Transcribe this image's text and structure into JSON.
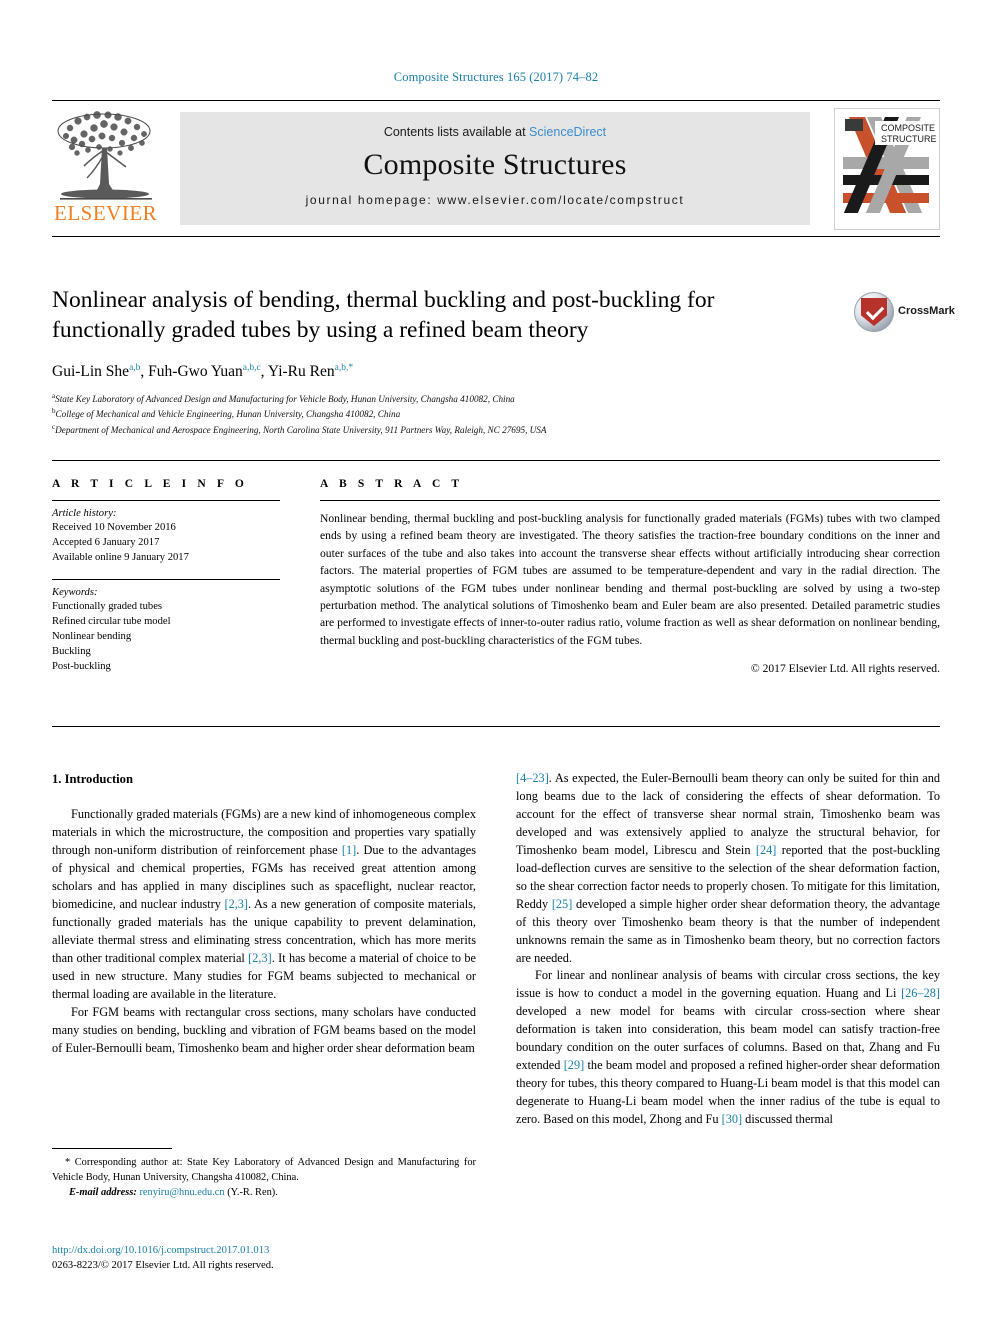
{
  "running_head": "Composite Structures 165 (2017) 74–82",
  "header": {
    "publisher": "ELSEVIER",
    "contents_prefix": "Contents lists available at ",
    "contents_link": "ScienceDirect",
    "journal_name": "Composite Structures",
    "homepage": "journal homepage: www.elsevier.com/locate/compstruct",
    "cover_title_line1": "COMPOSITE",
    "cover_title_line2": "STRUCTURES"
  },
  "article": {
    "title": "Nonlinear analysis of bending, thermal buckling and post-buckling for functionally graded tubes by using a refined beam theory",
    "authors_html": "Gui-Lin She <sup>a,b</sup>, Fuh-Gwo Yuan <sup>a,b,c</sup>, Yi-Ru Ren <sup>a,b,</sup>*",
    "affiliations": [
      "State Key Laboratory of Advanced Design and Manufacturing for Vehicle Body, Hunan University, Changsha 410082, China",
      "College of Mechanical and Vehicle Engineering, Hunan University, Changsha 410082, China",
      "Department of Mechanical and Aerospace Engineering, North Carolina State University, 911 Partners Way, Raleigh, NC 27695, USA"
    ],
    "affiliation_marks": [
      "a",
      "b",
      "c"
    ],
    "crossmark_label": "CrossMark"
  },
  "article_info": {
    "heading": "A R T I C L E    I N F O",
    "history_label": "Article history:",
    "history": [
      "Received 10 November 2016",
      "Accepted 6 January 2017",
      "Available online 9 January 2017"
    ],
    "keywords_label": "Keywords:",
    "keywords": [
      "Functionally graded tubes",
      "Refined circular tube model",
      "Nonlinear bending",
      "Buckling",
      "Post-buckling"
    ]
  },
  "abstract": {
    "heading": "A B S T R A C T",
    "text": "Nonlinear bending, thermal buckling and post-buckling analysis for functionally graded materials (FGMs) tubes with two clamped ends by using a refined beam theory are investigated. The theory satisfies the traction-free boundary conditions on the inner and outer surfaces of the tube and also takes into account the transverse shear effects without artificially introducing shear correction factors. The material properties of FGM tubes are assumed to be temperature-dependent and vary in the radial direction. The asymptotic solutions of the FGM tubes under nonlinear bending and thermal post-buckling are solved by using a two-step perturbation method. The analytical solutions of Timoshenko beam and Euler beam are also presented. Detailed parametric studies are performed to investigate effects of inner-to-outer radius ratio, volume fraction as well as shear deformation on nonlinear bending, thermal buckling and post-buckling characteristics of the FGM tubes.",
    "copyright": "© 2017 Elsevier Ltd. All rights reserved."
  },
  "body": {
    "section_heading": "1. Introduction",
    "left_paragraph_1_a": "Functionally graded materials (FGMs) are a new kind of inhomogeneous complex materials in which the microstructure, the composition and properties vary spatially through non-uniform distribution of reinforcement phase ",
    "ref_1": "[1]",
    "left_paragraph_1_b": ". Due to the advantages of physical and chemical properties, FGMs has received great attention among scholars and has applied in many disciplines such as spaceflight, nuclear reactor, biomedicine, and nuclear industry ",
    "ref_2_3_a": "[2,3]",
    "left_paragraph_1_c": ". As a new generation of composite materials, functionally graded materials has the unique capability to prevent delamination, alleviate thermal stress and eliminating stress concentration, which has more merits than other traditional complex material ",
    "ref_2_3_b": "[2,3]",
    "left_paragraph_1_d": ". It has become a material of choice to be used in new structure. Many studies for FGM beams subjected to mechanical or thermal loading are available in the literature.",
    "left_paragraph_2": "For FGM beams with rectangular cross sections, many scholars have conducted many studies on bending, buckling and vibration of FGM beams based on the model of Euler-Bernoulli beam, Timoshenko beam and higher order shear deformation beam",
    "ref_4_23": "[4–23]",
    "right_paragraph_1_a": ". As expected, the Euler-Bernoulli beam theory can only be suited for thin and long beams due to the lack of considering the effects of shear deformation. To account for the effect of transverse shear normal strain, Timoshenko beam was developed and was extensively applied to analyze the structural behavior, for Timoshenko beam model, Librescu and Stein ",
    "ref_24": "[24]",
    "right_paragraph_1_b": " reported that the post-buckling load-deflection curves are sensitive to the selection of the shear deformation faction, so the shear correction factor needs to properly chosen. To mitigate for this limitation, Reddy ",
    "ref_25": "[25]",
    "right_paragraph_1_c": " developed a simple higher order shear deformation theory, the advantage of this theory over Timoshenko beam theory is that the number of independent unknowns remain the same as in Timoshenko beam theory, but no correction factors are needed.",
    "right_paragraph_2_a": "For linear and nonlinear analysis of beams with circular cross sections, the key issue is how to conduct a model in the governing equation. Huang and Li ",
    "ref_26_28": "[26–28]",
    "right_paragraph_2_b": " developed a new model for beams with circular cross-section where shear deformation is taken into consideration, this beam model can satisfy traction-free boundary condition on the outer surfaces of columns. Based on that, Zhang and Fu extended ",
    "ref_29": "[29]",
    "right_paragraph_2_c": " the beam model and proposed a refined higher-order shear deformation theory for tubes, this theory compared to Huang-Li beam model is that this model can degenerate to Huang-Li beam model when the inner radius of the tube is equal to zero. Based on this model, Zhong and Fu ",
    "ref_30": "[30]",
    "right_paragraph_2_d": " discussed thermal"
  },
  "footnote": {
    "marker": "*",
    "corresponding": " Corresponding author at: State Key Laboratory of Advanced Design and Manufacturing for Vehicle Body, Hunan University, Changsha 410082, China.",
    "email_label": "E-mail address:",
    "email": "renyiru@hnu.edu.cn",
    "email_suffix": " (Y.-R. Ren)."
  },
  "footer": {
    "doi": "http://dx.doi.org/10.1016/j.compstruct.2017.01.013",
    "issn_line": "0263-8223/© 2017 Elsevier Ltd. All rights reserved."
  },
  "colors": {
    "link": "#1a7fa8",
    "sciencedirect": "#3a8bcd",
    "elsevier_orange": "#f08122",
    "band_gray": "#e5e5e5"
  }
}
